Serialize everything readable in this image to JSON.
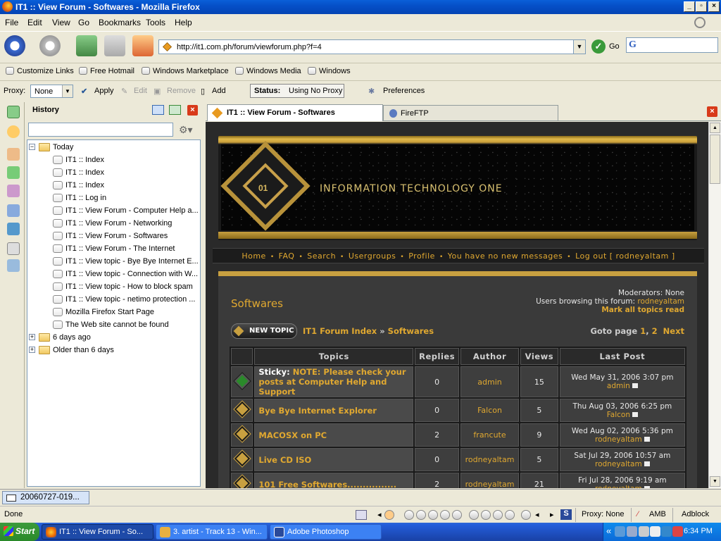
{
  "window": {
    "title": "IT1 :: View Forum - Softwares - Mozilla Firefox"
  },
  "menu": [
    "File",
    "Edit",
    "View",
    "Go",
    "Bookmarks",
    "Tools",
    "Help"
  ],
  "nav": {
    "url": "http://it1.com.ph/forum/viewforum.php?f=4",
    "go_label": "Go"
  },
  "bookmarks": [
    "Customize Links",
    "Free Hotmail",
    "Windows Marketplace",
    "Windows Media",
    "Windows"
  ],
  "proxy": {
    "label": "Proxy:",
    "selected": "None",
    "apply": "Apply",
    "edit": "Edit",
    "remove": "Remove",
    "add": "Add",
    "status_label": "Status:",
    "status_value": "Using No Proxy",
    "preferences": "Preferences"
  },
  "sidebar": {
    "title": "History",
    "groups": [
      {
        "label": "Today",
        "expanded": true,
        "items": [
          "IT1 :: Index",
          "IT1 :: Index",
          "IT1 :: Index",
          "IT1 :: Log in",
          "IT1 :: View Forum - Computer Help a...",
          "IT1 :: View Forum - Networking",
          "IT1 :: View Forum - Softwares",
          "IT1 :: View Forum - The Internet",
          "IT1 :: View topic - Bye Bye Internet E...",
          "IT1 :: View topic - Connection with W...",
          "IT1 :: View topic - How to block spam",
          "IT1 :: View topic - netimo protection ...",
          "Mozilla Firefox Start Page",
          "The Web site cannot be found"
        ]
      },
      {
        "label": "6 days ago",
        "expanded": false,
        "items": []
      },
      {
        "label": "Older than 6 days",
        "expanded": false,
        "items": []
      }
    ]
  },
  "tabs": [
    {
      "label": "IT1 :: View Forum - Softwares",
      "active": true
    },
    {
      "label": "FireFTP",
      "active": false
    }
  ],
  "site": {
    "logo_text": "01",
    "brand": "INFORMATION TECHNOLOGY ONE",
    "nav": [
      "Home",
      "FAQ",
      "Search",
      "Usergroups",
      "Profile",
      "You have no new messages",
      "Log out [ rodneyaltam ]"
    ]
  },
  "forum": {
    "name": "Softwares",
    "moderators": "Moderators: None",
    "browsing_label": "Users browsing this forum:",
    "browsing_user": "rodneyaltam",
    "mark_read": "Mark all topics read",
    "new_topic": "NEW TOPIC",
    "crumb_index": "IT1 Forum Index",
    "crumb_sep": "»",
    "crumb_forum": "Softwares",
    "goto_label": "Goto page",
    "pages": [
      "1",
      "2"
    ],
    "next": "Next",
    "columns": [
      "Topics",
      "Replies",
      "Author",
      "Views",
      "Last Post"
    ],
    "topics": [
      {
        "prefix": "Sticky:",
        "title": "NOTE: Please check your posts at Computer Help and Support",
        "replies": "0",
        "author": "admin",
        "views": "15",
        "last_date": "Wed May 31, 2006 3:07 pm",
        "last_user": "admin",
        "sticky": true
      },
      {
        "prefix": "",
        "title": "Bye Bye Internet Explorer",
        "replies": "0",
        "author": "Falcon",
        "views": "5",
        "last_date": "Thu Aug 03, 2006 6:25 pm",
        "last_user": "Falcon",
        "sticky": false
      },
      {
        "prefix": "",
        "title": "MACOSX on PC",
        "replies": "2",
        "author": "francute",
        "views": "9",
        "last_date": "Wed Aug 02, 2006 5:36 pm",
        "last_user": "rodneyaltam",
        "sticky": false
      },
      {
        "prefix": "",
        "title": "Live CD ISO",
        "replies": "0",
        "author": "rodneyaltam",
        "views": "5",
        "last_date": "Sat Jul 29, 2006 10:57 am",
        "last_user": "rodneyaltam",
        "sticky": false
      },
      {
        "prefix": "",
        "title": "101 Free Softwares................",
        "replies": "2",
        "author": "rodneyaltam",
        "views": "21",
        "last_date": "Fri Jul 28, 2006 9:19 am",
        "last_user": "rodneyaltam",
        "sticky": false
      }
    ]
  },
  "download": {
    "label": "20060727-019..."
  },
  "status": {
    "text": "Done",
    "proxy": "Proxy: None",
    "amb": "AMB",
    "adblock": "Adblock"
  },
  "taskbar": {
    "start": "Start",
    "tasks": [
      "IT1 :: View Forum - So...",
      "3. artist - Track 13 - Win...",
      "Adobe Photoshop"
    ],
    "clock": "6:34 PM",
    "tray_chevron": "«"
  },
  "colors": {
    "accent": "#e0a830",
    "titlebar": "#0550c8",
    "forum_bg": "#3a3a3a"
  }
}
